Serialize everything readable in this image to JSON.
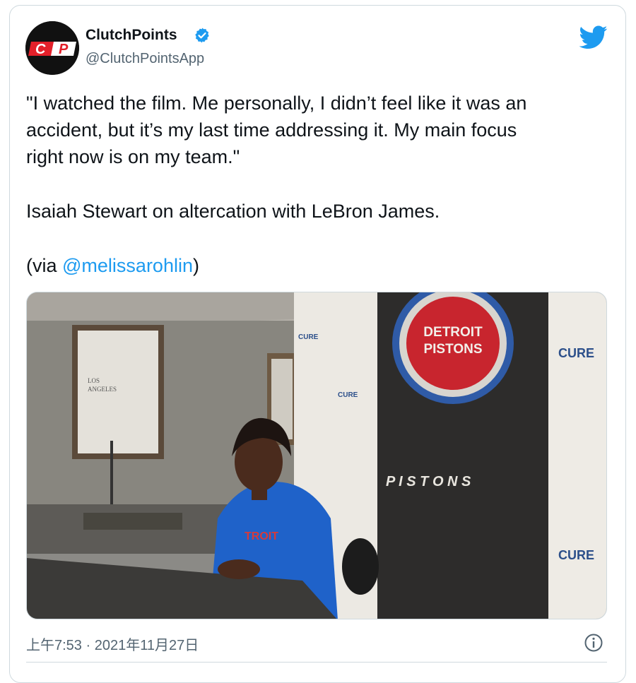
{
  "tweet": {
    "author_name": "ClutchPoints",
    "author_handle": "@ClutchPointsApp",
    "avatar_text": "CP",
    "quote_lines": [
      "\"I watched the film. Me personally, I didn’t feel like it was an",
      "accident, but it’s my last time addressing it. My main focus",
      "right now is on my team.\""
    ],
    "line2": "Isaiah Stewart on altercation with LeBron James.",
    "via_prefix": "(via ",
    "mention": "@melissarohlin",
    "via_suffix": ")",
    "timestamp": "上午7:53 · 2021年11月27日"
  },
  "media": {
    "frame_text": [
      "LOS",
      "ANGELES"
    ],
    "logo_text": [
      "DETROIT",
      "PISTONS"
    ],
    "backdrop_word": "P I S T O N S",
    "sponsor": "CURE",
    "sponsor_small": "CURE",
    "jersey_text": "TROIT"
  },
  "colors": {
    "accent": "#1d9bf0",
    "text": "#0f1419",
    "secondary": "#536471",
    "border": "#cfd9de",
    "avatar_red": "#e4202a"
  },
  "icons": {
    "verified": "verified-badge-icon",
    "twitter": "twitter-bird-icon",
    "info": "info-icon"
  }
}
